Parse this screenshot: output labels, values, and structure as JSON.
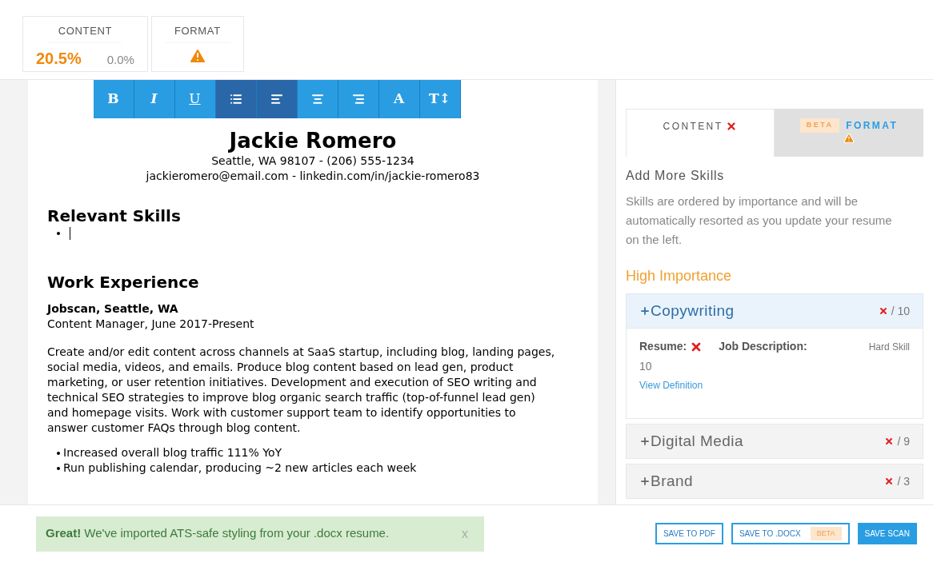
{
  "scores": [
    {
      "label": "CONTENT",
      "kind": "percent",
      "value": "20.5%",
      "secondary": "0.0%"
    },
    {
      "label": "FORMAT",
      "kind": "warning"
    }
  ],
  "toolbar": [
    {
      "kind": "bold",
      "label": "B",
      "selected": false
    },
    {
      "kind": "italic",
      "label": "I",
      "selected": false
    },
    {
      "kind": "underline",
      "label": "U",
      "selected": false
    },
    {
      "kind": "list",
      "selected": true
    },
    {
      "kind": "left",
      "selected": true
    },
    {
      "kind": "center",
      "selected": false
    },
    {
      "kind": "right",
      "selected": false
    },
    {
      "kind": "bold",
      "label": "A",
      "selected": false
    },
    {
      "kind": "bold",
      "label": "T↕",
      "selected": false
    }
  ],
  "resume": {
    "name": "Jackie Romero",
    "contact": [
      "Seattle, WA 98107 - (206) 555-1234",
      "jackieromero@email.com - linkedin.com/in/jackie-romero83"
    ],
    "sections": [
      {
        "heading": "Relevant Skills"
      },
      {
        "heading": "Work Experience",
        "employer": "Jobscan, Seattle, WA",
        "role": "Content Manager, June 2017-Present",
        "paragraph": "Create and/or edit content across channels at SaaS startup, including blog, landing pages, social media, videos, and emails. Produce blog content based on lead gen, product marketing, or user retention initiatives. Development and execution of SEO writing and technical SEO strategies to improve blog organic search traffic (top-of-funnel lead gen) and homepage visits. Work with customer support team to identify opportunities to answer customer FAQs through blog content.",
        "bullets": [
          "Increased overall blog traffic 111% YoY",
          "Run publishing calendar, producing ~2 new articles each week"
        ]
      }
    ]
  },
  "tabs": [
    {
      "label": "CONTENT",
      "selected": true,
      "kind": "error"
    },
    {
      "label": "FORMAT",
      "badge": "BETA",
      "selected": false,
      "kind": "warning"
    }
  ],
  "panel": {
    "title": "Add More Skills",
    "description": "Skills are ordered by importance and will be automatically resorted as you update your resume on the left.",
    "group": "High Importance",
    "skills": [
      {
        "name": "Copywriting",
        "count": "/ 10",
        "expanded": true,
        "resume_label": "Resume:",
        "jd_label": "Job Description:",
        "type": "Hard Skill",
        "jd_count": "10",
        "link": "View Definition"
      },
      {
        "name": "Digital Media",
        "count": "/ 9",
        "expanded": false
      },
      {
        "name": "Brand",
        "count": "/ 3",
        "expanded": false
      }
    ]
  },
  "notice": {
    "text": "**Great!** We've imported ATS-safe styling from your .docx resume.",
    "close": "x"
  },
  "buttons": [
    {
      "label": "SAVE TO PDF",
      "kind": "outline"
    },
    {
      "label": "SAVE TO .DOCX",
      "badge": "BETA",
      "kind": "outline"
    },
    {
      "label": "SAVE SCAN",
      "kind": "solid"
    }
  ]
}
